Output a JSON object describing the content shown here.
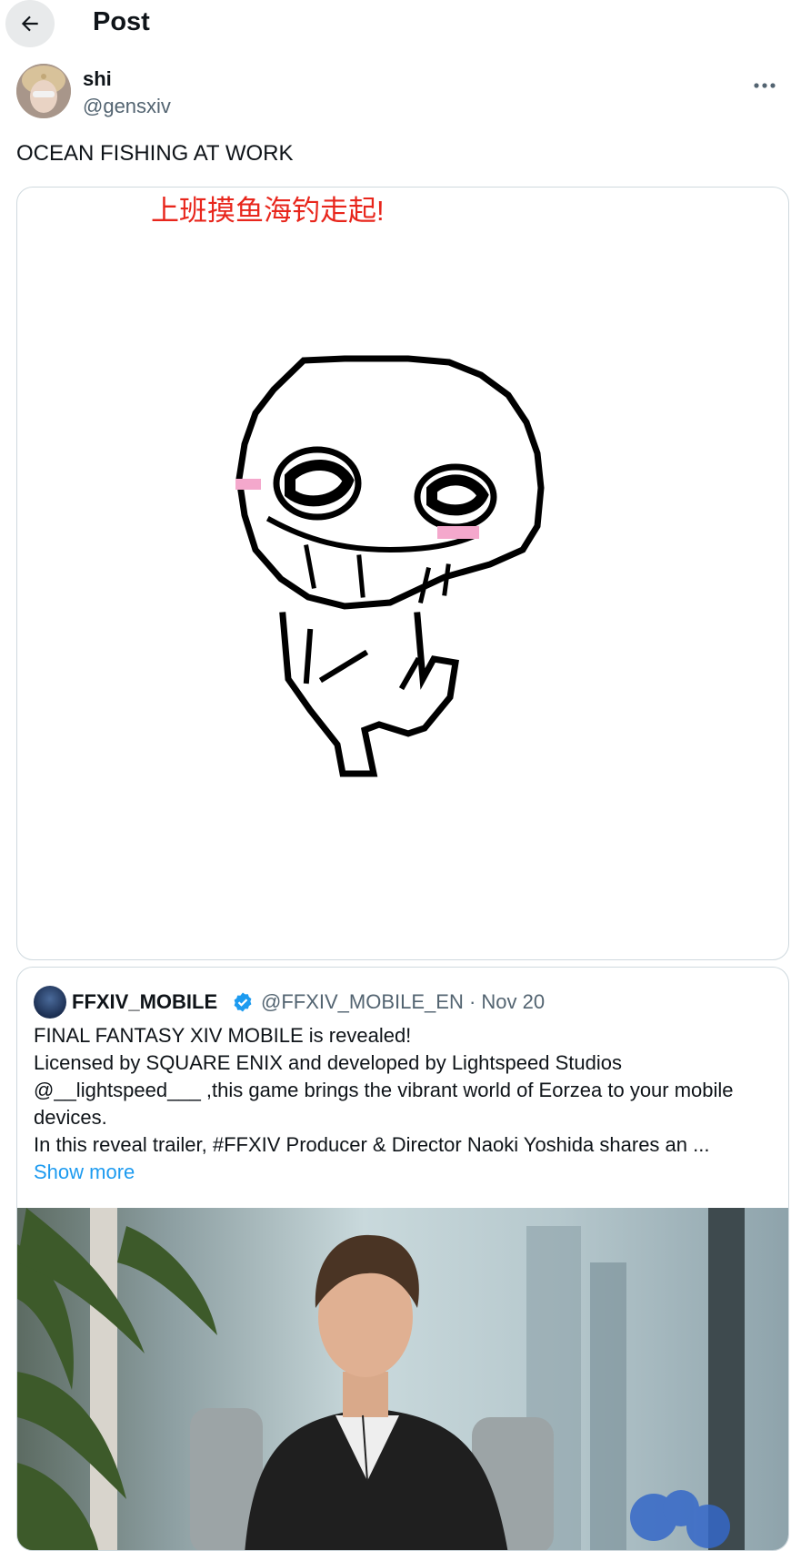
{
  "header": {
    "title": "Post"
  },
  "post": {
    "author_name": "shi",
    "author_handle": "@gensxiv",
    "text": "OCEAN FISHING AT WORK",
    "image_caption": "上班摸鱼海钓走起!"
  },
  "quote": {
    "author_name": "FFXIV_MOBILE",
    "author_handle": "@FFXIV_MOBILE_EN",
    "separator": "·",
    "date": "Nov 20",
    "lines": [
      "FINAL FANTASY XIV MOBILE is revealed!",
      "Licensed by SQUARE ENIX and developed by Lightspeed Studios",
      "@__lightspeed___ ,this game brings the vibrant world of Eorzea to your mobile",
      "devices.",
      "In this reveal trailer, #FFXIV Producer & Director Naoki Yoshida shares an ..."
    ],
    "show_more": "Show more"
  },
  "colors": {
    "accent": "#1d9bf0",
    "caption_red": "#e8261c",
    "secondary_text": "#536471",
    "border": "#cfd9de"
  },
  "icons": [
    "back-arrow-icon",
    "more-icon",
    "verified-badge-icon"
  ]
}
